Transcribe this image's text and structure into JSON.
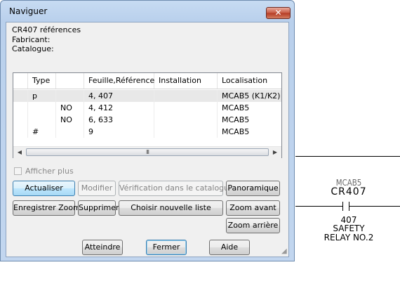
{
  "dialog": {
    "title": "Naviguer",
    "close_glyph": "✕",
    "info": {
      "references": "CR407 références",
      "fabricant": "Fabricant:",
      "catalogue": "Catalogue:"
    },
    "grid": {
      "headers": [
        "",
        "Type",
        "",
        "Feuille,Référence",
        "Installation",
        "Localisation"
      ],
      "rows": [
        [
          "",
          "p",
          "",
          "4, 407",
          "",
          "MCAB5 (K1/K2)"
        ],
        [
          "",
          "",
          "NO",
          "4, 412",
          "",
          "MCAB5"
        ],
        [
          "",
          "",
          "NO",
          "6, 633",
          "",
          "MCAB5"
        ],
        [
          "",
          "#",
          "",
          "9",
          "",
          "MCAB5"
        ]
      ],
      "scroll_left": "◀",
      "scroll_right": "▶",
      "thumb_grip": "III"
    },
    "show_more": {
      "label": "Afficher plus",
      "checked": false
    },
    "buttons": {
      "refresh": "Actualiser",
      "modify": "Modifier",
      "catalog_check": "Vérification dans le catalogue",
      "pan": "Panoramique",
      "save_zoom": "Enregistrer Zoom",
      "delete": "Supprimer",
      "choose_list": "Choisir nouvelle liste",
      "zoom_in": "Zoom avant",
      "zoom_out": "Zoom arrière",
      "goto": "Atteindre",
      "close": "Fermer",
      "help": "Aide"
    }
  },
  "drawing": {
    "location": "MCAB5",
    "tag": "CR407",
    "ref": "407",
    "desc1": "SAFETY",
    "desc2": "RELAY NO.2"
  },
  "colors": {
    "title_bar": "#c3d7f0",
    "close_button": "#c75a43",
    "selected_row": "#e8e8e8",
    "primary_button": "#bee6fd"
  }
}
